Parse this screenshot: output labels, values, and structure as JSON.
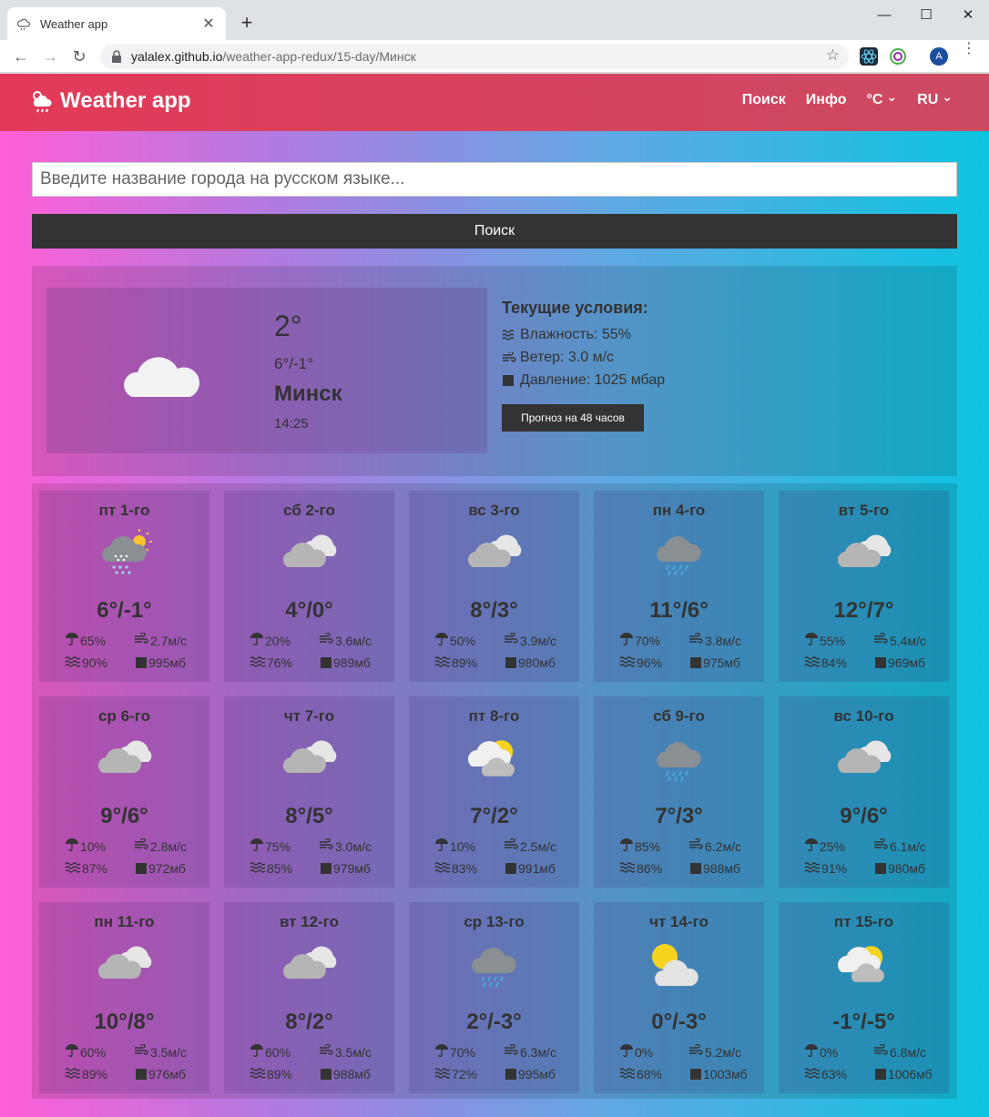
{
  "browser": {
    "tab_title": "Weather app",
    "url_host": "yalalex.github.io",
    "url_path": "/weather-app-redux/15-day/Минск",
    "avatar_letter": "A"
  },
  "app": {
    "brand": "Weather app",
    "nav": {
      "search": "Поиск",
      "info": "Инфо",
      "units": "°C",
      "lang": "RU"
    },
    "search": {
      "placeholder": "Введите название города на русском языке...",
      "button": "Поиск"
    },
    "current": {
      "icon": "cloud-icon",
      "temp": "2°",
      "range": "6°/-1°",
      "city": "Минск",
      "time": "14:25",
      "title": "Текущие условия:",
      "humidity": "Влажность: 55%",
      "wind": "Ветер: 3.0 м/с",
      "pressure": "Давление: 1025 мбар",
      "button": "Прогноз на 48 часов"
    },
    "days": [
      {
        "name": "пт 1-го",
        "icon": "snow-sun",
        "temp": "6°/-1°",
        "precip": "65%",
        "wind": "2.7м/с",
        "humidity": "90%",
        "pressure": "995мб"
      },
      {
        "name": "сб 2-го",
        "icon": "clouds",
        "temp": "4°/0°",
        "precip": "20%",
        "wind": "3.6м/с",
        "humidity": "76%",
        "pressure": "989мб"
      },
      {
        "name": "вс 3-го",
        "icon": "clouds",
        "temp": "8°/3°",
        "precip": "50%",
        "wind": "3.9м/с",
        "humidity": "89%",
        "pressure": "980мб"
      },
      {
        "name": "пн 4-го",
        "icon": "rain",
        "temp": "11°/6°",
        "precip": "70%",
        "wind": "3.8м/с",
        "humidity": "96%",
        "pressure": "975мб"
      },
      {
        "name": "вт 5-го",
        "icon": "clouds",
        "temp": "12°/7°",
        "precip": "55%",
        "wind": "5.4м/с",
        "humidity": "84%",
        "pressure": "969мб"
      },
      {
        "name": "ср 6-го",
        "icon": "clouds",
        "temp": "9°/6°",
        "precip": "10%",
        "wind": "2.8м/с",
        "humidity": "87%",
        "pressure": "972мб"
      },
      {
        "name": "чт 7-го",
        "icon": "clouds",
        "temp": "8°/5°",
        "precip": "75%",
        "wind": "3.0м/с",
        "humidity": "85%",
        "pressure": "979мб"
      },
      {
        "name": "пт 8-го",
        "icon": "partly-cloudy",
        "temp": "7°/2°",
        "precip": "10%",
        "wind": "2.5м/с",
        "humidity": "83%",
        "pressure": "991мб"
      },
      {
        "name": "сб 9-го",
        "icon": "rain",
        "temp": "7°/3°",
        "precip": "85%",
        "wind": "6.2м/с",
        "humidity": "86%",
        "pressure": "988мб"
      },
      {
        "name": "вс 10-го",
        "icon": "clouds",
        "temp": "9°/6°",
        "precip": "25%",
        "wind": "6.1м/с",
        "humidity": "91%",
        "pressure": "980мб"
      },
      {
        "name": "пн 11-го",
        "icon": "clouds",
        "temp": "10°/8°",
        "precip": "60%",
        "wind": "3.5м/с",
        "humidity": "89%",
        "pressure": "976мб"
      },
      {
        "name": "вт 12-го",
        "icon": "clouds",
        "temp": "8°/2°",
        "precip": "60%",
        "wind": "3.5м/с",
        "humidity": "89%",
        "pressure": "988мб"
      },
      {
        "name": "ср 13-го",
        "icon": "rain",
        "temp": "2°/-3°",
        "precip": "70%",
        "wind": "6.3м/с",
        "humidity": "72%",
        "pressure": "995мб"
      },
      {
        "name": "чт 14-го",
        "icon": "sun-cloud",
        "temp": "0°/-3°",
        "precip": "0%",
        "wind": "5.2м/с",
        "humidity": "68%",
        "pressure": "1003мб"
      },
      {
        "name": "пт 15-го",
        "icon": "partly-cloudy",
        "temp": "-1°/-5°",
        "precip": "0%",
        "wind": "6.8м/с",
        "humidity": "63%",
        "pressure": "1006мб"
      }
    ]
  }
}
